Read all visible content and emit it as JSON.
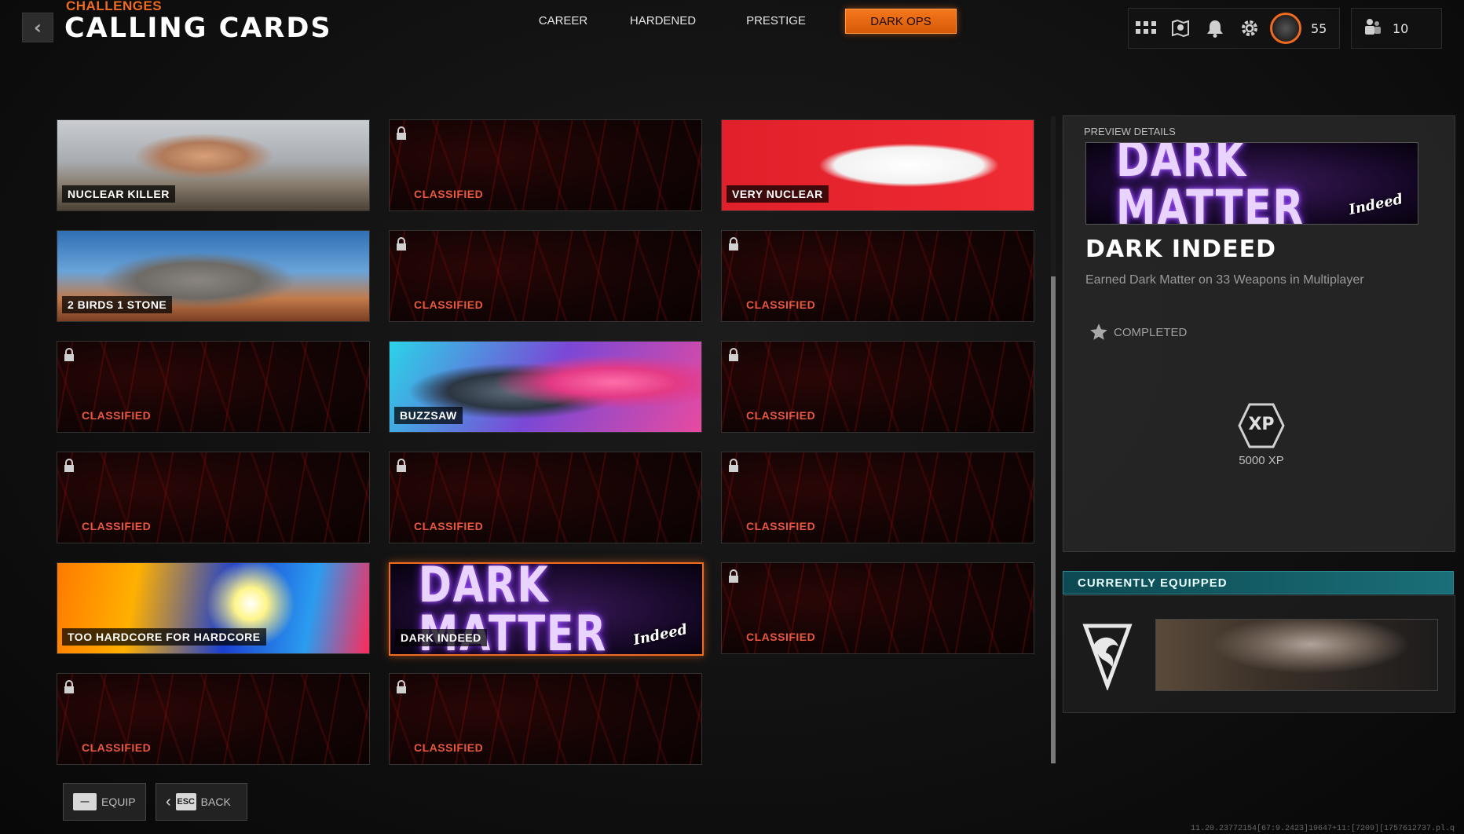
{
  "header": {
    "breadcrumb": "CHALLENGES",
    "title": "CALLING CARDS",
    "back_icon": "chevron-left-icon"
  },
  "tabs": [
    {
      "label": "CAREER",
      "active": false
    },
    {
      "label": "HARDENED",
      "active": false
    },
    {
      "label": "PRESTIGE",
      "active": false
    },
    {
      "label": "DARK OPS",
      "active": true
    }
  ],
  "topbar": {
    "icons": [
      "grid-icon",
      "map-icon",
      "bell-icon",
      "gear-icon"
    ],
    "level": "55",
    "friends_count": "10"
  },
  "cards": [
    {
      "label": "NUCLEAR KILLER",
      "locked": false,
      "art": "nuclear"
    },
    {
      "label": "CLASSIFIED",
      "locked": true
    },
    {
      "label": "VERY NUCLEAR",
      "locked": false,
      "art": "verynuclear"
    },
    {
      "label": "2 BIRDS 1 STONE",
      "locked": false,
      "art": "birds"
    },
    {
      "label": "CLASSIFIED",
      "locked": true
    },
    {
      "label": "CLASSIFIED",
      "locked": true
    },
    {
      "label": "CLASSIFIED",
      "locked": true
    },
    {
      "label": "BUZZSAW",
      "locked": false,
      "art": "buzzsaw"
    },
    {
      "label": "CLASSIFIED",
      "locked": true
    },
    {
      "label": "CLASSIFIED",
      "locked": true
    },
    {
      "label": "CLASSIFIED",
      "locked": true
    },
    {
      "label": "CLASSIFIED",
      "locked": true
    },
    {
      "label": "TOO HARDCORE FOR HARDCORE",
      "locked": false,
      "art": "hardcore"
    },
    {
      "label": "DARK INDEED",
      "locked": false,
      "art": "darkmatter",
      "selected": true
    },
    {
      "label": "CLASSIFIED",
      "locked": true
    },
    {
      "label": "CLASSIFIED",
      "locked": true
    },
    {
      "label": "CLASSIFIED",
      "locked": true
    }
  ],
  "card_art_text": {
    "main": "DARK MATTER",
    "sub": "Indeed"
  },
  "preview": {
    "header": "PREVIEW DETAILS",
    "title": "DARK INDEED",
    "description": "Earned Dark Matter on 33 Weapons in Multiplayer",
    "status": "COMPLETED",
    "xp_badge": "XP",
    "xp_amount": "5000 XP"
  },
  "equipped": {
    "header": "CURRENTLY EQUIPPED"
  },
  "buttons": {
    "equip": {
      "key": "—",
      "label": "EQUIP"
    },
    "back": {
      "key": "ESC",
      "label": "BACK"
    }
  },
  "version": "11.20.23772154[67:9.2423]19647+11:[7209][1757612737.pl.q",
  "colors": {
    "accent": "#f06a1f",
    "classified": "#e9573f",
    "equipped_teal": "#1a6f78"
  }
}
